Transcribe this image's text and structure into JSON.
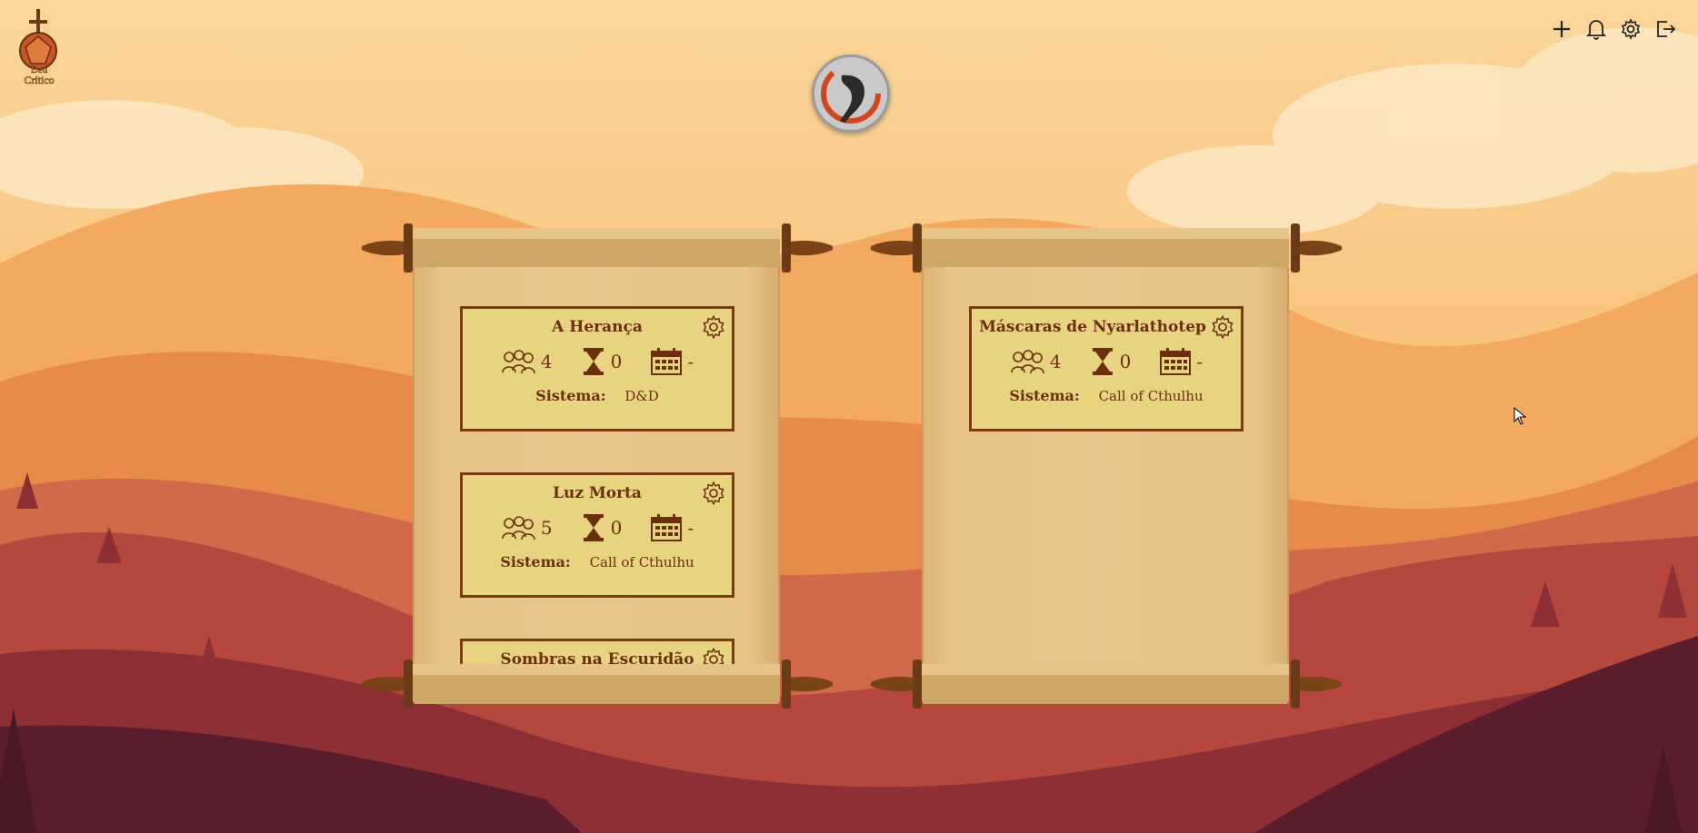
{
  "app": {
    "logo_icon": "deu-critico-logo",
    "logo_text_line1": "Deu",
    "logo_text_line2": "Crítico"
  },
  "header": {
    "actions": [
      {
        "name": "add-icon"
      },
      {
        "name": "bell-icon"
      },
      {
        "name": "gear-icon"
      },
      {
        "name": "logout-icon"
      }
    ]
  },
  "profile": {
    "avatar_icon": "user-avatar"
  },
  "scrolls": [
    {
      "cards": [
        {
          "title": "A Herança",
          "players": "4",
          "sessions": "0",
          "next_date": "-",
          "system_label": "Sistema:",
          "system": "D&D"
        },
        {
          "title": "Luz Morta",
          "players": "5",
          "sessions": "0",
          "next_date": "-",
          "system_label": "Sistema:",
          "system": "Call of Cthulhu"
        },
        {
          "title": "Sombras na Escuridão",
          "players": "",
          "sessions": "",
          "next_date": "",
          "system_label": "",
          "system": ""
        }
      ]
    },
    {
      "cards": [
        {
          "title": "Máscaras de Nyarlathotep",
          "players": "4",
          "sessions": "0",
          "next_date": "-",
          "system_label": "Sistema:",
          "system": "Call of Cthulhu"
        }
      ]
    }
  ],
  "colors": {
    "card_bg": "#e7d380",
    "card_border": "#7b3a10",
    "text": "#6b2f0c"
  }
}
